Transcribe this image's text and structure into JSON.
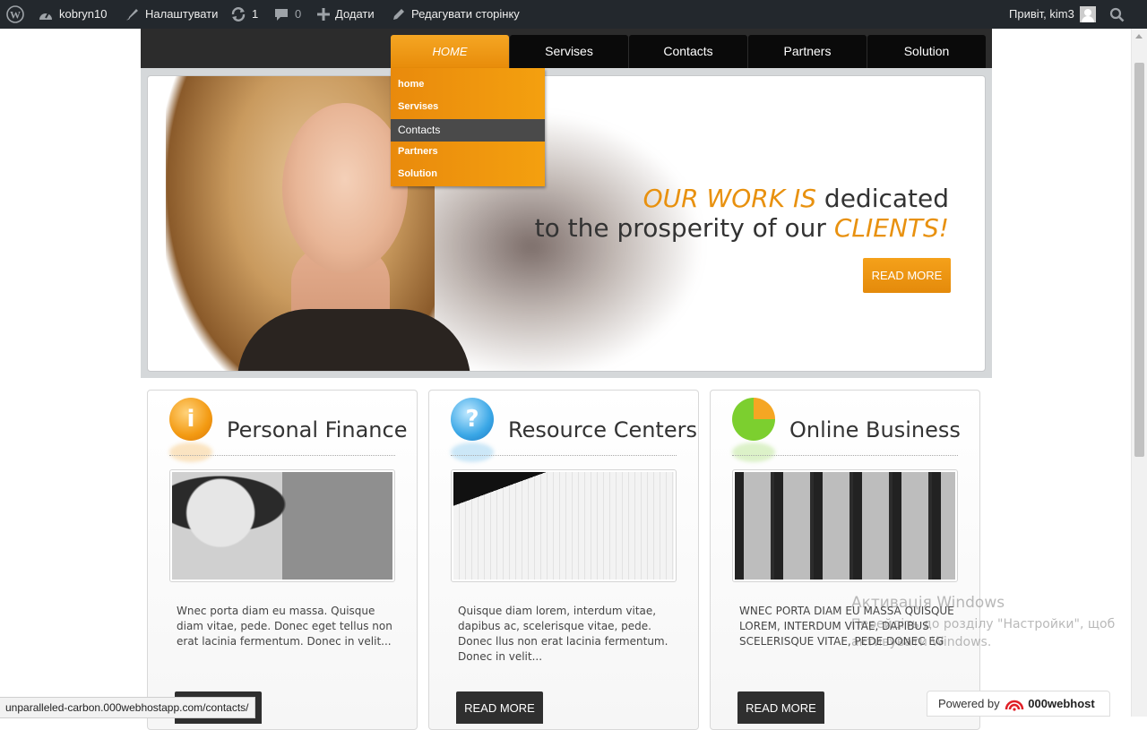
{
  "adminbar": {
    "site_name": "kobryn10",
    "customize": "Налаштувати",
    "updates": "1",
    "comments": "0",
    "add_new": "Додати",
    "edit_page": "Редагувати сторінку",
    "greeting": "Привіт, kim3"
  },
  "nav": {
    "items": [
      "HOME",
      "Servises",
      "Contacts",
      "Partners",
      "Solution"
    ]
  },
  "dropdown": {
    "items": [
      "home",
      "Servises",
      "Contacts",
      "Partners",
      "Solution"
    ],
    "hovered": "Contacts"
  },
  "slider": {
    "line1_accent": "OUR WORK IS",
    "line1_rest": " dedicated",
    "line2_rest": "to the prosperity of our ",
    "line2_accent": "CLIENTS!",
    "button": "READ MORE"
  },
  "cards": [
    {
      "title": "Personal Finance",
      "icon": "info-i-icon",
      "text": "Wnec porta diam eu massa. Quisque diam vitae, pede. Donec eget tellus non erat lacinia fermentum. Donec in velit...",
      "button": "READ MORE"
    },
    {
      "title": "Resource Centers",
      "icon": "info-bubble-icon",
      "text": "Quisque diam lorem, interdum vitae, dapibus ac, scelerisque vitae, pede. Donec llus non erat lacinia fermentum. Donec in velit...",
      "button": "READ MORE"
    },
    {
      "title": "Online Business",
      "icon": "pie-chart-icon",
      "text": "WNEC PORTA DIAM EU MASSA QUISQUE LOREM, INTERDUM VITAE, DAPIBUS SCELERISQUE VITAE, PEDE DONEC EG",
      "button": "READ MORE"
    }
  ],
  "watermark": {
    "title": "Активація Windows",
    "line1": "Перейдіть до розділу \"Настройки\", щоб",
    "line2": "активувати Windows."
  },
  "status_url": "unparalleled-carbon.000webhostapp.com/contacts/",
  "powered": {
    "label": "Powered by",
    "brand": "000webhost"
  },
  "colors": {
    "accent": "#e8910f",
    "adminbar": "#23282d",
    "nav_bg": "#0a0a0a"
  }
}
